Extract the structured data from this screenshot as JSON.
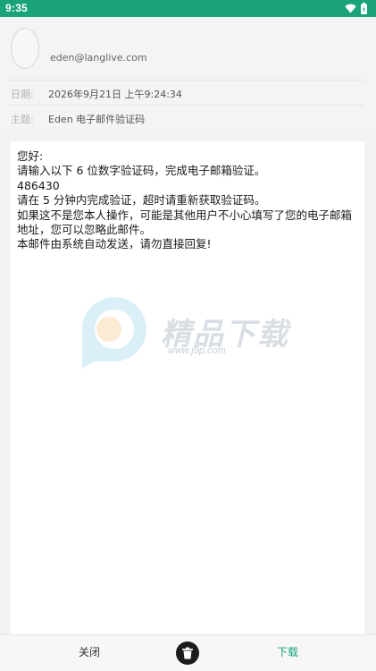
{
  "status_bar": {
    "time": "9:35",
    "background": "#1aa37a",
    "icons": [
      "wifi-icon",
      "battery-icon"
    ]
  },
  "email": {
    "sender": "eden@langlive.com",
    "date_label": "日期:",
    "date_value": "2026年9月21日 上午9:24:34",
    "subject_label": "主题:",
    "subject_value": "Eden 电子邮件验证码",
    "body_lines": [
      "您好:",
      "请输入以下 6 位数字验证码，完成电子邮箱验证。",
      "486430",
      "请在 5 分钟内完成验证，超时请重新获取验证码。",
      "如果这不是您本人操作，可能是其他用户不小心填写了您的电子邮箱",
      "地址，您可以忽略此邮件。",
      "本邮件由系统自动发送，请勿直接回复!"
    ]
  },
  "watermark": {
    "title": "精品下载",
    "url": "www.j9p.com",
    "icon": "p-logo-icon"
  },
  "bottom_bar": {
    "close_label": "关闭",
    "delete_icon": "trash-icon",
    "download_label": "下载",
    "accent": "#1aa37a"
  }
}
